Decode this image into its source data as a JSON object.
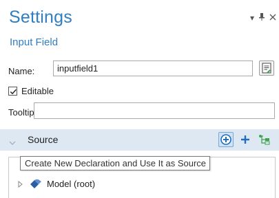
{
  "panel": {
    "title": "Settings",
    "subtitle": "Input Field",
    "window_controls": [
      "▾",
      "⊣",
      "✕"
    ]
  },
  "form": {
    "name_label": "Name:",
    "name_value": "inputfield1",
    "editable_label": "Editable",
    "editable_checked": true,
    "tooltip_label": "Tooltip:",
    "tooltip_value": ""
  },
  "source": {
    "title": "Source",
    "tooltip_text": "Create New Declaration and Use It as Source",
    "tree": [
      {
        "label": "Model (root)",
        "icon": "model-icon",
        "expanded": false
      }
    ]
  },
  "colors": {
    "accent": "#2f7ec1",
    "section_bg": "#dde8f3",
    "add_icon": "#1f6fbf",
    "tree_icon": "#3fa34d",
    "model_icon": "#2a5fa3"
  }
}
